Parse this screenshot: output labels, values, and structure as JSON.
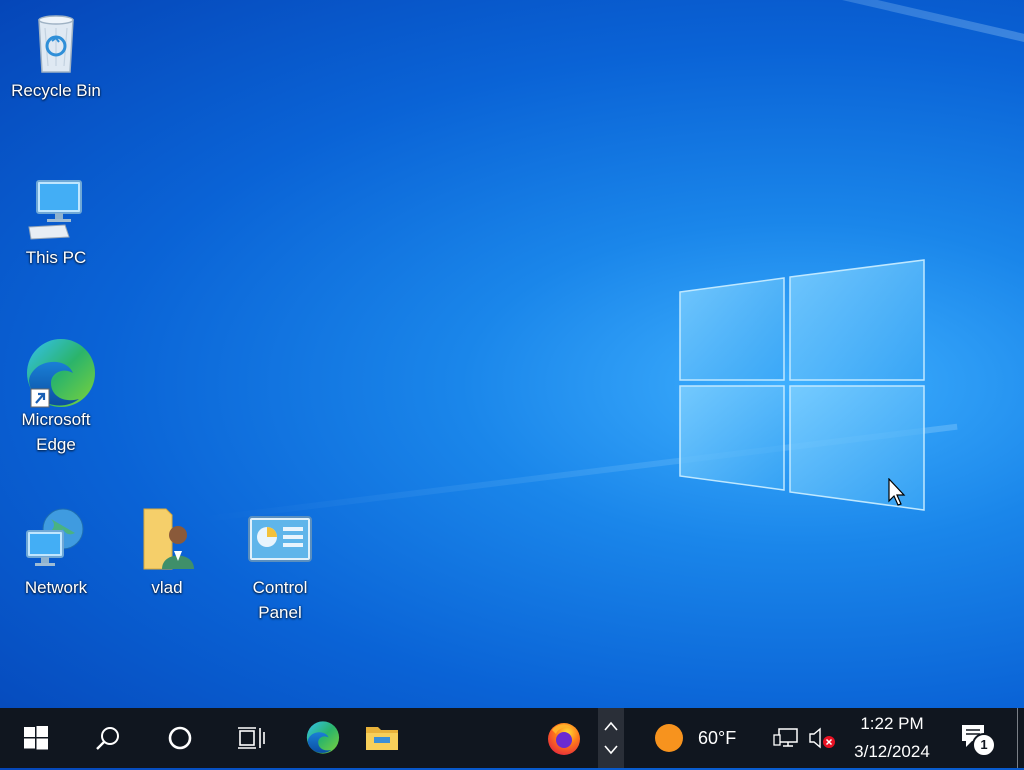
{
  "desktop": {
    "icons": [
      {
        "label": "Recycle Bin",
        "icon": "recycle-bin-icon"
      },
      {
        "label": "This PC",
        "icon": "computer-icon"
      },
      {
        "label_line1": "Microsoft",
        "label_line2": "Edge",
        "icon": "edge-icon"
      },
      {
        "label": "Network",
        "icon": "network-icon"
      },
      {
        "label": "vlad",
        "icon": "user-folder-icon"
      },
      {
        "label": "Control Panel",
        "icon": "control-panel-icon"
      }
    ]
  },
  "taskbar": {
    "weather": {
      "temperature": "60°F",
      "icon": "sun-icon"
    },
    "clock": {
      "time": "1:22 PM",
      "date": "3/12/2024"
    },
    "notifications": {
      "count": "1"
    },
    "pinned": [
      "start-icon",
      "search-icon",
      "cortana-icon",
      "task-view-icon",
      "edge-icon",
      "file-explorer-icon",
      "firefox-icon"
    ]
  }
}
